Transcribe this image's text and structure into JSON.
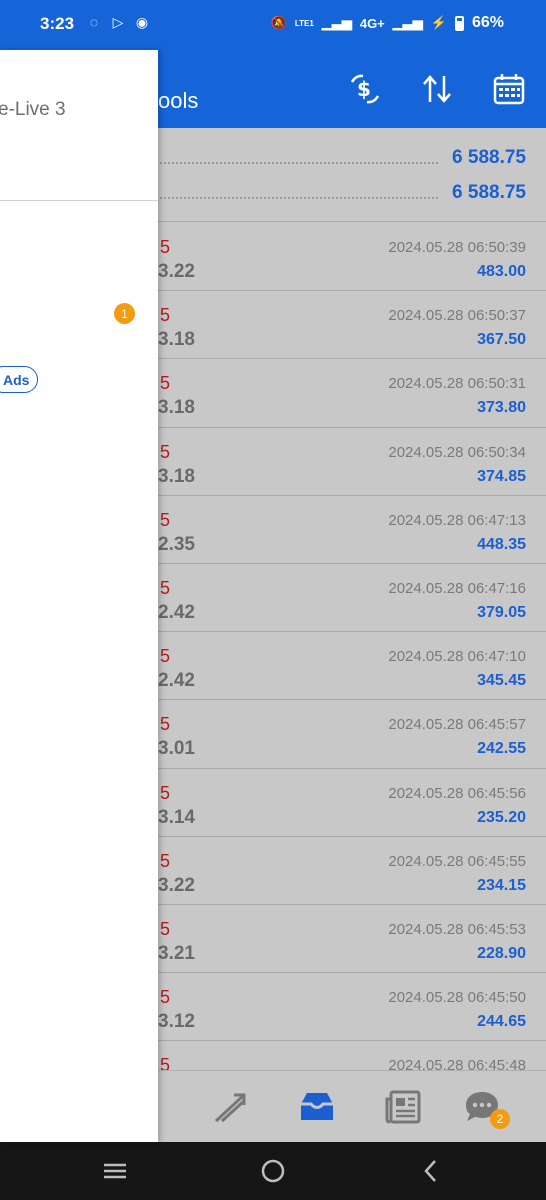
{
  "status_bar": {
    "time": "3:23",
    "network_label": "4G+",
    "battery": "66%",
    "lte_label": "LTE1"
  },
  "header": {
    "title_partial": "ools"
  },
  "balance": {
    "row1_value": "6 588.75",
    "row2_value": "6 588.75"
  },
  "trades": [
    {
      "symbol_partial": "5",
      "price_partial": "3.22",
      "time": "2024.05.28 06:50:39",
      "profit": "483.00"
    },
    {
      "symbol_partial": "5",
      "price_partial": "3.18",
      "time": "2024.05.28 06:50:37",
      "profit": "367.50"
    },
    {
      "symbol_partial": "5",
      "price_partial": "3.18",
      "time": "2024.05.28 06:50:31",
      "profit": "373.80"
    },
    {
      "symbol_partial": "5",
      "price_partial": "3.18",
      "time": "2024.05.28 06:50:34",
      "profit": "374.85"
    },
    {
      "symbol_partial": "5",
      "price_partial": "2.35",
      "time": "2024.05.28 06:47:13",
      "profit": "448.35"
    },
    {
      "symbol_partial": "5",
      "price_partial": "2.42",
      "time": "2024.05.28 06:47:16",
      "profit": "379.05"
    },
    {
      "symbol_partial": "5",
      "price_partial": "2.42",
      "time": "2024.05.28 06:47:10",
      "profit": "345.45"
    },
    {
      "symbol_partial": "5",
      "price_partial": "3.01",
      "time": "2024.05.28 06:45:57",
      "profit": "242.55"
    },
    {
      "symbol_partial": "5",
      "price_partial": "3.14",
      "time": "2024.05.28 06:45:56",
      "profit": "235.20"
    },
    {
      "symbol_partial": "5",
      "price_partial": "3.22",
      "time": "2024.05.28 06:45:55",
      "profit": "234.15"
    },
    {
      "symbol_partial": "5",
      "price_partial": "3.21",
      "time": "2024.05.28 06:45:53",
      "profit": "228.90"
    },
    {
      "symbol_partial": "5",
      "price_partial": "3.12",
      "time": "2024.05.28 06:45:50",
      "profit": "244.65"
    },
    {
      "symbol_partial": "5",
      "price_partial": "",
      "time": "2024.05.28 06:45:48",
      "profit": ""
    }
  ],
  "drawer": {
    "account_label_partial": "e-Live 3",
    "notification_count": "1",
    "ads_label": "Ads"
  },
  "tabbar": {
    "chat_badge": "2",
    "tabs": [
      "trade-icon",
      "history-icon",
      "news-icon",
      "chat-icon"
    ]
  },
  "colors": {
    "primary": "#1565d8",
    "profit_blue": "#1b5fd1",
    "symbol_red": "#b71c1c",
    "badge_orange": "#f39c12"
  }
}
